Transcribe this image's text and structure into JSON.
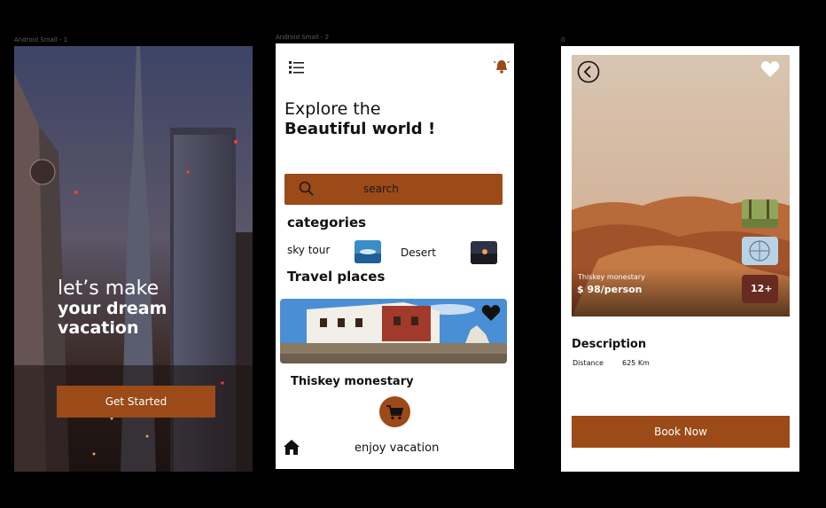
{
  "frames": {
    "f1_label": "Android Small - 1",
    "f2_label": "Android Small - 2",
    "f3_label": "0"
  },
  "screen1": {
    "headline_line1": "let’s make",
    "headline_line2": "your dream",
    "headline_line3": "vacation",
    "cta_label": "Get Started"
  },
  "screen2": {
    "heading_line1": "Explore the",
    "heading_line2": "Beautiful world !",
    "search_label": "search",
    "categories_title": "categories",
    "categories": [
      {
        "label": "sky tour"
      },
      {
        "label": "Desert"
      }
    ],
    "travel_title": "Travel places",
    "place_name": "Thiskey monestary",
    "footer_text": "enjoy vacation"
  },
  "screen3": {
    "place_name": "Thiskey monestary",
    "price": "$ 98/person",
    "more_count": "12+",
    "description_title": "Description",
    "distance_label": "Distance",
    "distance_value": "625 Km",
    "book_label": "Book Now"
  },
  "colors": {
    "accent": "#9b4a18",
    "background": "#000000"
  },
  "icons": [
    "menu-list-icon",
    "bell-icon",
    "search-icon",
    "heart-icon",
    "cart-icon",
    "home-icon",
    "back-arrow-icon"
  ]
}
